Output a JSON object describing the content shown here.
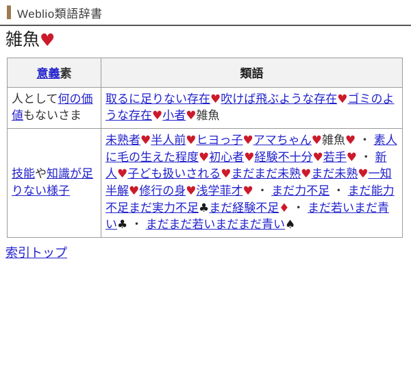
{
  "header": {
    "site_name": "Weblio類語辞書",
    "accent_color": "#9c7a4e"
  },
  "page": {
    "headword": "雑魚",
    "headword_suit": "♥"
  },
  "table": {
    "headers": {
      "sense_link": "意義",
      "sense_tail": "素",
      "synonym": "類語"
    },
    "rows": [
      {
        "sense": {
          "pre": "人として",
          "link": "何の価値",
          "post": "もないさま"
        },
        "synonyms_line": "取るに足りない存在♥吹けば飛ぶような存在♥ゴミのような存在♥小者♥雑魚",
        "synonyms": [
          {
            "text": "取るに足りない存在",
            "link": true,
            "suit": "♥",
            "suit_kind": "heart"
          },
          {
            "text": "吹けば飛ぶような存在",
            "link": true,
            "suit": "♥",
            "suit_kind": "heart"
          },
          {
            "text": "ゴミのような存在",
            "link": true,
            "suit": "♥",
            "suit_kind": "heart"
          },
          {
            "text": "小者",
            "link": true,
            "suit": "♥",
            "suit_kind": "heart"
          },
          {
            "text": "雑魚",
            "link": false,
            "suit": "",
            "suit_kind": ""
          }
        ]
      },
      {
        "sense": {
          "pre": "",
          "link": "技能",
          "mid": "や",
          "link2": "知識が足りない様子",
          "post": ""
        },
        "synonyms_line": "未熟者♥半人前♥ヒヨっ子♥アマちゃん♥雑魚♥素人に毛の生えた程度♥・初心者♥経験不十分♥若手♥新人♥・子ども扱いされる♥まだまだ未熟♥まだ未熟♥一知半解♥修行の身♥浅学菲才♥まだ力不足・まだ能力不足・まだ実力不足♣まだ経験不足♦まだ若い・まだ青い♣まだまだ若い・まだまだ青い♠",
        "synonyms": [
          {
            "text": "未熟者",
            "link": true,
            "suit": "♥",
            "suit_kind": "heart"
          },
          {
            "text": "半人前",
            "link": true,
            "suit": "♥",
            "suit_kind": "heart"
          },
          {
            "text": "ヒヨっ子",
            "link": true,
            "suit": "♥",
            "suit_kind": "heart"
          },
          {
            "text": "アマちゃん",
            "link": true,
            "suit": "♥",
            "suit_kind": "heart"
          },
          {
            "text": "雑魚",
            "link": false,
            "suit": "♥",
            "suit_kind": "heart"
          },
          {
            "text": "素人に毛の生えた程度",
            "link": true,
            "suit": "♥",
            "suit_kind": "heart",
            "sep": "・"
          },
          {
            "text": "初心者",
            "link": true,
            "suit": "♥",
            "suit_kind": "heart"
          },
          {
            "text": "経験不十分",
            "link": true,
            "suit": "♥",
            "suit_kind": "heart"
          },
          {
            "text": "若手",
            "link": true,
            "suit": "♥",
            "suit_kind": "heart"
          },
          {
            "text": "新人",
            "link": true,
            "suit": "♥",
            "suit_kind": "heart",
            "sep": "・"
          },
          {
            "text": "子ども扱いされる",
            "link": true,
            "suit": "♥",
            "suit_kind": "heart"
          },
          {
            "text": "まだまだ未熟",
            "link": true,
            "suit": "♥",
            "suit_kind": "heart"
          },
          {
            "text": "まだ未熟",
            "link": true,
            "suit": "♥",
            "suit_kind": "heart"
          },
          {
            "text": "一知半解",
            "link": true,
            "suit": "♥",
            "suit_kind": "heart"
          },
          {
            "text": "修行の身",
            "link": true,
            "suit": "♥",
            "suit_kind": "heart"
          },
          {
            "text": "浅学菲才",
            "link": true,
            "suit": "♥",
            "suit_kind": "heart"
          },
          {
            "text": "まだ力不足",
            "link": true,
            "suit": "",
            "suit_kind": "",
            "sep": "・"
          },
          {
            "text": "まだ能力不足",
            "link": true,
            "suit": "",
            "suit_kind": "",
            "sep": "・"
          },
          {
            "text": "まだ実力不足",
            "link": true,
            "suit": "♣",
            "suit_kind": "club"
          },
          {
            "text": "まだ経験不足",
            "link": true,
            "suit": "♦",
            "suit_kind": "diamond"
          },
          {
            "text": "まだ若い",
            "link": true,
            "suit": "",
            "suit_kind": "",
            "sep": "・"
          },
          {
            "text": "まだ青い",
            "link": true,
            "suit": "♣",
            "suit_kind": "club"
          },
          {
            "text": "まだまだ若い",
            "link": true,
            "suit": "",
            "suit_kind": "",
            "sep": "・"
          },
          {
            "text": "まだまだ青い",
            "link": true,
            "suit": "♠",
            "suit_kind": "spade"
          }
        ]
      }
    ]
  },
  "footer": {
    "index_top_label": "索引トップ"
  }
}
